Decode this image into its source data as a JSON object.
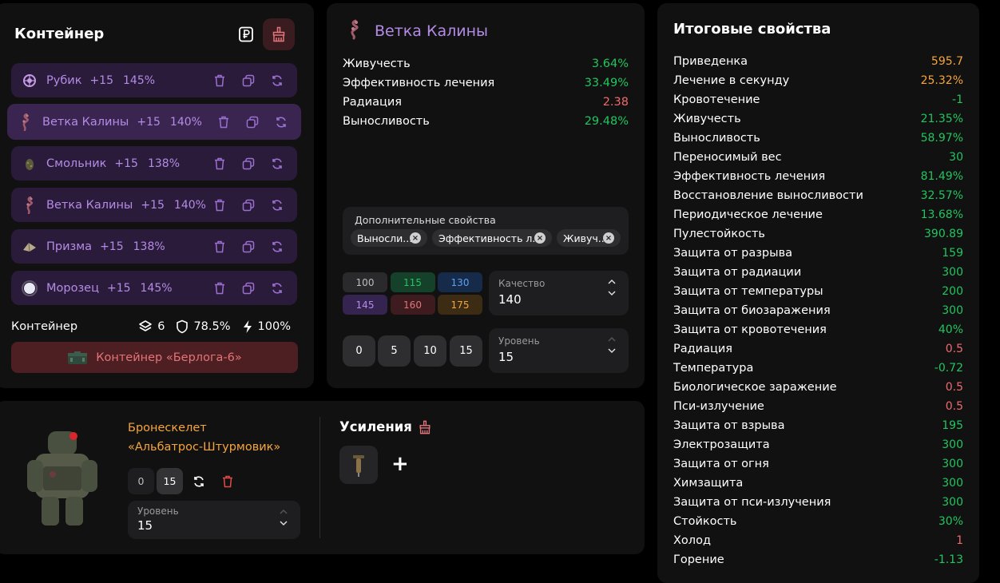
{
  "container_panel": {
    "title": "Контейнер",
    "artifacts": [
      {
        "name": "Рубик",
        "level": "+15",
        "percent": "145%",
        "icon": "rubik-artifact-icon"
      },
      {
        "name": "Ветка Калины",
        "level": "+15",
        "percent": "140%",
        "icon": "kalina-branch-artifact-icon"
      },
      {
        "name": "Смольник",
        "level": "+15",
        "percent": "138%",
        "icon": "smolnik-artifact-icon"
      },
      {
        "name": "Ветка Калины",
        "level": "+15",
        "percent": "140%",
        "icon": "kalina-branch-artifact-icon"
      },
      {
        "name": "Призма",
        "level": "+15",
        "percent": "138%",
        "icon": "prism-artifact-icon"
      },
      {
        "name": "Морозец",
        "level": "+15",
        "percent": "145%",
        "icon": "morozets-artifact-icon"
      }
    ],
    "footer_label": "Контейнер",
    "slots": "6",
    "protection": "78.5%",
    "efficiency": "100%",
    "container_button": "Контейнер «Берлога-6»"
  },
  "artifact_panel": {
    "title": "Ветка Калины",
    "properties": [
      {
        "name": "Живучесть",
        "value": "3.64%",
        "color": "green"
      },
      {
        "name": "Эффективность лечения",
        "value": "33.49%",
        "color": "green"
      },
      {
        "name": "Радиация",
        "value": "2.38",
        "color": "red"
      },
      {
        "name": "Выносливость",
        "value": "29.48%",
        "color": "green"
      }
    ],
    "extra_label": "Дополнительные свойства",
    "extra_chips": [
      "Выносли...",
      "Эффективность л...",
      "Живуч..."
    ],
    "quality_buttons": [
      {
        "label": "100",
        "bg": "#2a2a2c",
        "fg": "#bdbdbd"
      },
      {
        "label": "115",
        "bg": "#15402a",
        "fg": "#22c55e"
      },
      {
        "label": "130",
        "bg": "#162a4a",
        "fg": "#5ea1f0"
      },
      {
        "label": "145",
        "bg": "#352350",
        "fg": "#b48be6"
      },
      {
        "label": "160",
        "bg": "#3d1b1e",
        "fg": "#e2747a"
      },
      {
        "label": "175",
        "bg": "#3d2c14",
        "fg": "#f6a53a"
      }
    ],
    "quality_label": "Качество",
    "quality_value": "140",
    "level_buttons": [
      "0",
      "5",
      "10",
      "15"
    ],
    "level_label": "Уровень",
    "level_value": "15"
  },
  "armor_panel": {
    "name_line1": "Бронескелет",
    "name_line2": "«Альбатрос-Штурмовик»",
    "level_min": "0",
    "level_max": "15",
    "level_label": "Уровень",
    "level_value": "15",
    "boost_title": "Усиления",
    "add_symbol": "+"
  },
  "totals_panel": {
    "title": "Итоговые свойства",
    "rows": [
      {
        "name": "Приведенка",
        "value": "595.7",
        "color": "orange"
      },
      {
        "name": "Лечение в секунду",
        "value": "25.32%",
        "color": "orange"
      },
      {
        "name": "Кровотечение",
        "value": "-1",
        "color": "green"
      },
      {
        "name": "Живучесть",
        "value": "21.35%",
        "color": "green"
      },
      {
        "name": "Выносливость",
        "value": "58.97%",
        "color": "green"
      },
      {
        "name": "Переносимый вес",
        "value": "30",
        "color": "green"
      },
      {
        "name": "Эффективность лечения",
        "value": "81.49%",
        "color": "green"
      },
      {
        "name": "Восстановление выносливости",
        "value": "32.57%",
        "color": "green"
      },
      {
        "name": "Периодическое лечение",
        "value": "13.68%",
        "color": "green"
      },
      {
        "name": "Пулестойкость",
        "value": "390.89",
        "color": "green"
      },
      {
        "name": "Защита от разрыва",
        "value": "159",
        "color": "green"
      },
      {
        "name": "Защита от радиации",
        "value": "300",
        "color": "green"
      },
      {
        "name": "Защита от температуры",
        "value": "200",
        "color": "green"
      },
      {
        "name": "Защита от биозаражения",
        "value": "300",
        "color": "green"
      },
      {
        "name": "Защита от кровотечения",
        "value": "40%",
        "color": "green"
      },
      {
        "name": "Радиация",
        "value": "0.5",
        "color": "red"
      },
      {
        "name": "Температура",
        "value": "-0.72",
        "color": "green"
      },
      {
        "name": "Биологическое заражение",
        "value": "0.5",
        "color": "red"
      },
      {
        "name": "Пси-излучение",
        "value": "0.5",
        "color": "red"
      },
      {
        "name": "Защита от взрыва",
        "value": "195",
        "color": "green"
      },
      {
        "name": "Электрозащита",
        "value": "300",
        "color": "green"
      },
      {
        "name": "Защита от огня",
        "value": "300",
        "color": "green"
      },
      {
        "name": "Химзащита",
        "value": "300",
        "color": "green"
      },
      {
        "name": "Защита от пси-излучения",
        "value": "300",
        "color": "green"
      },
      {
        "name": "Стойкость",
        "value": "30%",
        "color": "green"
      },
      {
        "name": "Холод",
        "value": "1",
        "color": "red"
      },
      {
        "name": "Горение",
        "value": "-1.13",
        "color": "green"
      }
    ]
  }
}
